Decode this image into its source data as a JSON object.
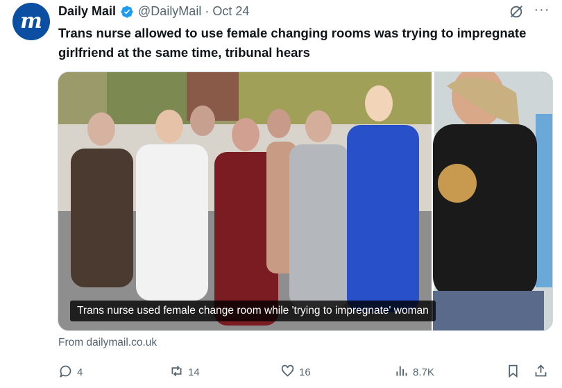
{
  "author": {
    "name": "Daily Mail",
    "handle": "@DailyMail",
    "date": "Oct 24",
    "avatar_letter": "m",
    "verified": true
  },
  "post": {
    "text": "Trans nurse allowed to use female changing rooms was trying to impregnate girlfriend at the same time, tribunal hears"
  },
  "card": {
    "caption": "Trans nurse used female change room while 'trying to impregnate' woman",
    "source": "From dailymail.co.uk"
  },
  "actions": {
    "replies": "4",
    "reposts": "14",
    "likes": "16",
    "views": "8.7K"
  },
  "icons": {
    "avatar": "daily-mail-logo",
    "verified": "verified-badge-icon",
    "grok": "grok-icon",
    "more": "more-icon",
    "reply": "reply-icon",
    "repost": "repost-icon",
    "like": "heart-icon",
    "views": "views-icon",
    "bookmark": "bookmark-icon",
    "share": "share-icon"
  },
  "colors": {
    "brand": "#0b4ea2",
    "verified": "#1d9bf0",
    "text": "#0f1419",
    "muted": "#536471"
  }
}
